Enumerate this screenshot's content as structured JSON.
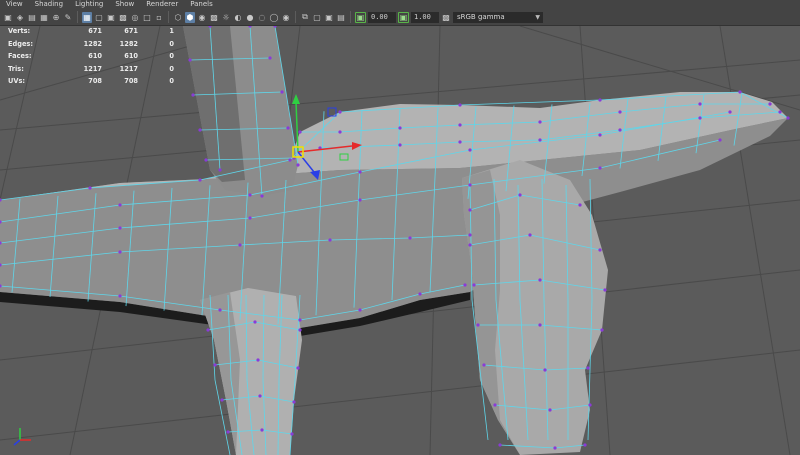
{
  "menu": [
    "View",
    "Shading",
    "Lighting",
    "Show",
    "Renderer",
    "Panels"
  ],
  "toolbar": {
    "icons_left": [
      "camera-select-icon",
      "camera-attributes-icon",
      "bookmarks-icon",
      "image-plane-icon",
      "2d-pan-zoom-icon",
      "grease-pencil-icon"
    ],
    "icons_display": [
      "grid-icon",
      "film-gate-icon",
      "resolution-gate-icon",
      "gate-mask-icon",
      "field-chart-icon",
      "safe-action-icon",
      "safe-title-icon"
    ],
    "icons_shading": [
      "wireframe-icon",
      "smooth-shade-icon",
      "default-material-icon",
      "textured-icon",
      "use-all-lights-icon",
      "shadows-icon",
      "screen-space-ao-icon",
      "motion-blur-icon",
      "anti-alias-icon",
      "depth-of-field-icon"
    ],
    "icons_isolate": [
      "isolate-select-icon",
      "xray-icon",
      "xray-active-components-icon",
      "xray-joints-icon"
    ],
    "exposure_value": "0.00",
    "gamma_value": "1.00",
    "color_space": "sRGB gamma"
  },
  "hud": {
    "rows": [
      {
        "label": "Verts:",
        "a": "671",
        "b": "671",
        "c": "1"
      },
      {
        "label": "Edges:",
        "a": "1282",
        "b": "1282",
        "c": "0"
      },
      {
        "label": "Faces:",
        "a": "610",
        "b": "610",
        "c": "0"
      },
      {
        "label": "Tris:",
        "a": "1217",
        "b": "1217",
        "c": "0"
      },
      {
        "label": "UVs:",
        "a": "708",
        "b": "708",
        "c": "0"
      }
    ]
  },
  "colors": {
    "background": "#5b5b5b",
    "grid_line": "#4a4a4a",
    "mesh_fill": "#a8a8a8",
    "wire": "#5fd6ea",
    "vertex": "#8a3bd8",
    "manip_x": "#e62a2a",
    "manip_y": "#2fd042",
    "manip_z": "#2a3fe6",
    "manip_center": "#f0e000",
    "menu_bg": "#444444",
    "active_button": "#5d7fa5"
  }
}
